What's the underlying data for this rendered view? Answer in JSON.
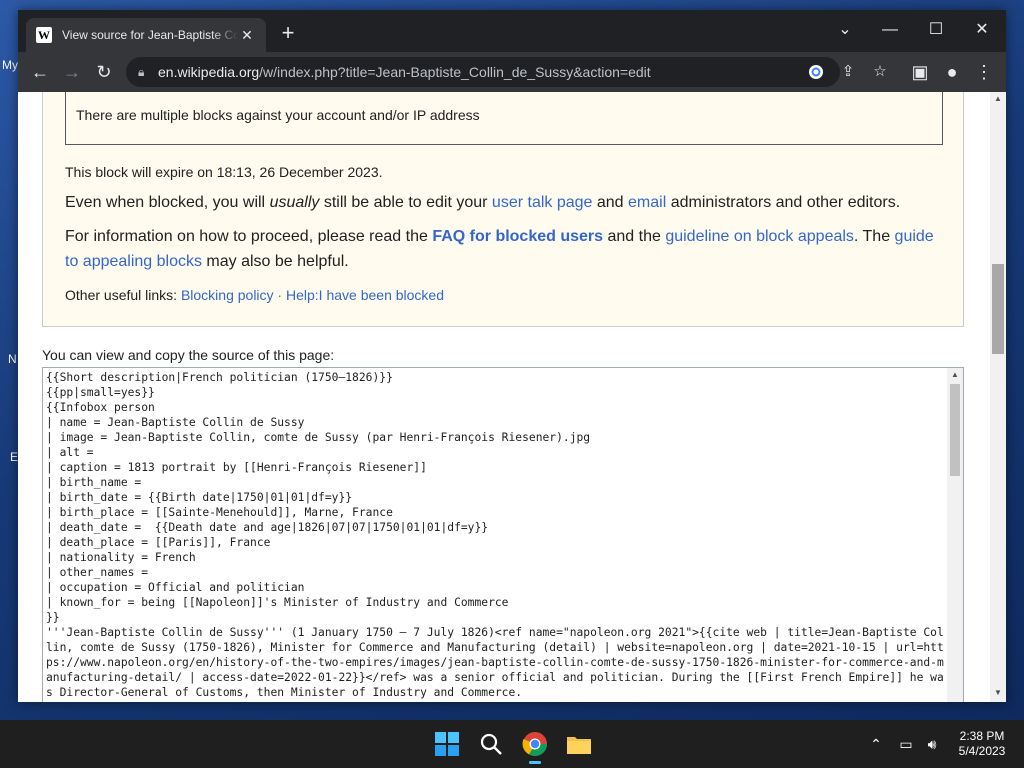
{
  "window": {
    "tab_title": "View source for Jean-Baptiste Collin de Sussy",
    "tab_favicon": "W",
    "url_host": "en.wikipedia.org",
    "url_path": "/w/index.php?title=Jean-Baptiste_Collin_de_Sussy&action=edit"
  },
  "notice": {
    "block_box_text": "There are multiple blocks against your account and/or IP address",
    "expire_text": "This block will expire on 18:13, 26 December 2023.",
    "line1_pre": "Even when blocked, you will ",
    "line1_em": "usually",
    "line1_mid": " still be able to edit your ",
    "line1_link1": "user talk page",
    "line1_and": " and ",
    "line1_link2": "email",
    "line1_post": " administrators and other editors.",
    "line2_pre": "For information on how to proceed, please read the ",
    "line2_link1": "FAQ for blocked users",
    "line2_mid": " and the ",
    "line2_link2": "guideline on block appeals",
    "line2_mid2": ". The ",
    "line2_link3a": "guide",
    "line2_link3b": "to appealing blocks",
    "line2_post": " may also be helpful.",
    "other_links_label": "Other useful links: ",
    "other_link1": "Blocking policy",
    "other_sep": " · ",
    "other_link2": "Help:I have been blocked"
  },
  "source": {
    "label": "You can view and copy the source of this page:",
    "text": "{{Short description|French politician (1750–1826)}}\n{{pp|small=yes}}\n{{Infobox person\n| name = Jean-Baptiste Collin de Sussy\n| image = Jean-Baptiste Collin, comte de Sussy (par Henri-François Riesener).jpg\n| alt =\n| caption = 1813 portrait by [[Henri-François Riesener]]\n| birth_name =\n| birth_date = {{Birth date|1750|01|01|df=y}}\n| birth_place = [[Sainte-Menehould]], Marne, France\n| death_date =  {{Death date and age|1826|07|07|1750|01|01|df=y}}\n| death_place = [[Paris]], France\n| nationality = French\n| other_names =\n| occupation = Official and politician\n| known_for = being [[Napoleon]]'s Minister of Industry and Commerce\n}}\n'''Jean-Baptiste Collin de Sussy''' (1 January 1750 – 7 July 1826)<ref name=\"napoleon.org 2021\">{{cite web | title=Jean-Baptiste Collin, comte de Sussy (1750-1826), Minister for Commerce and Manufacturing (detail) | website=napoleon.org | date=2021-10-15 | url=https://www.napoleon.org/en/history-of-the-two-empires/images/jean-baptiste-collin-comte-de-sussy-1750-1826-minister-for-commerce-and-manufacturing-detail/ | access-date=2022-01-22}}</ref> was a senior official and politician. During the [[First French Empire]] he was Director-General of Customs, then Minister of Industry and Commerce."
  },
  "desktop": {
    "frag1": "My",
    "frag2": "N",
    "frag3": "E"
  },
  "taskbar": {
    "time": "2:38 PM",
    "date": "5/4/2023"
  },
  "icons": {
    "back": "arrow-left-icon",
    "forward": "arrow-right-icon",
    "reload": "reload-icon",
    "lock": "lock-icon",
    "google": "google-icon",
    "share": "share-icon",
    "bookmark": "star-icon",
    "sidepanel": "side-panel-icon",
    "profile": "profile-icon",
    "menu": "kebab-menu-icon"
  },
  "colors": {
    "link": "#3366cc",
    "notice_bg": "#fffcef",
    "chrome_dark": "#202124",
    "chrome_toolbar": "#35363a"
  }
}
